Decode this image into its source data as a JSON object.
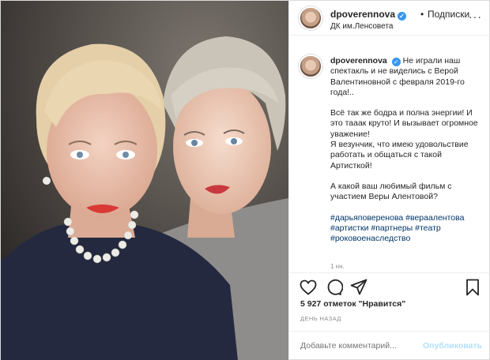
{
  "header": {
    "username": "dpoverennova",
    "verified_mark": "✓",
    "separator": "•",
    "follow_label": "Подписки",
    "location": "ДК им.Ленсовета",
    "more_label": "···"
  },
  "caption": {
    "username": "dpoverennova",
    "paragraphs": [
      "Не играли наш спектакль и не виделись с Верой Валентиновной с февраля 2019-го года!..",
      "Всё так же бодра и полна энергии! И это тааак круто! И вызывает огромное уважение!\nЯ везунчик, что имею удовольствие работать и общаться с такой Артисткой!",
      "А какой ваш любимый фильм с участием Веры Алентовой?"
    ],
    "hashtags": [
      "#дарьяповеренова",
      "#вераалентова",
      "#артистки",
      "#партнеры",
      "#театр",
      "#роковоенаследство"
    ],
    "time": "1 нн."
  },
  "actions": {
    "like_icon": "heart-icon",
    "comment_icon": "comment-icon",
    "share_icon": "share-icon",
    "save_icon": "bookmark-icon",
    "likes_text": "5 927 отметок \"Нравится\"",
    "date_text": "ДЕНЬ НАЗАД"
  },
  "comment": {
    "placeholder": "Добавьте комментарий...",
    "publish_label": "Опубликовать"
  },
  "colors": {
    "link": "#003569",
    "verified": "#3897f0",
    "publish_disabled": "#b2dffc",
    "muted": "#8e8e8e",
    "border": "#dbdbdb"
  }
}
